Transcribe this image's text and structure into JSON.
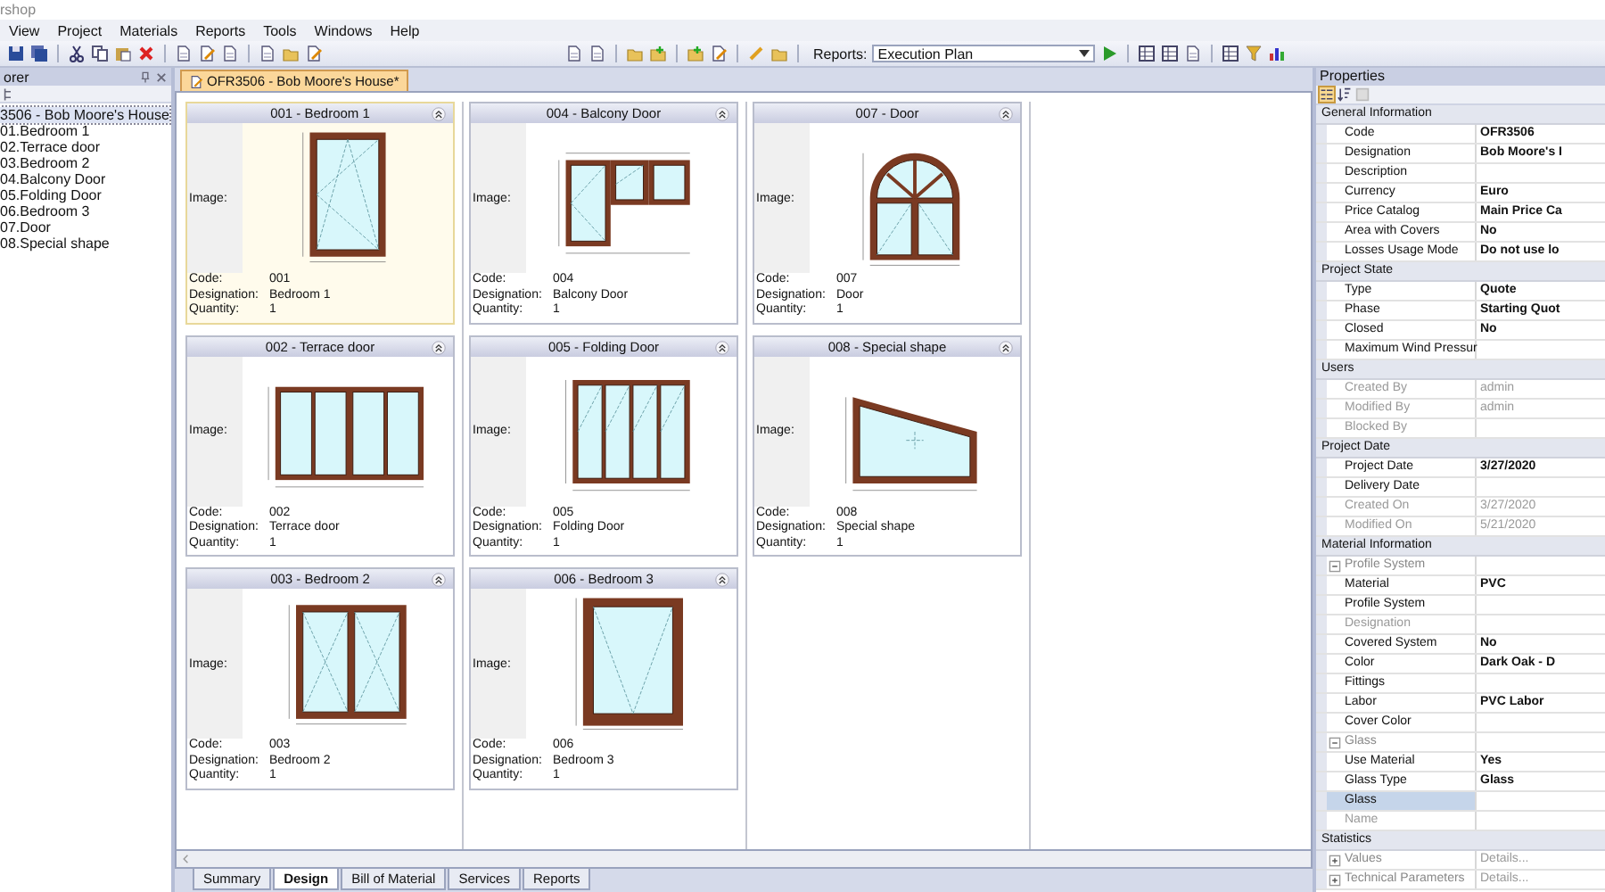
{
  "app": {
    "title": "rshop"
  },
  "menu": [
    "View",
    "Project",
    "Materials",
    "Reports",
    "Tools",
    "Windows",
    "Help"
  ],
  "toolbar": {
    "reports_label": "Reports:",
    "reports_value": "Execution Plan"
  },
  "explorer": {
    "title": "orer",
    "tree": {
      "label": "3506 - Bob Moore's House",
      "selected": true,
      "children": [
        {
          "label": "01.Bedroom 1",
          "selected": false
        },
        {
          "label": "02.Terrace door",
          "selected": false
        },
        {
          "label": "03.Bedroom 2",
          "selected": false
        },
        {
          "label": "04.Balcony Door",
          "selected": false
        },
        {
          "label": "05.Folding Door",
          "selected": false
        },
        {
          "label": "06.Bedroom 3",
          "selected": false
        },
        {
          "label": "07.Door",
          "selected": false
        },
        {
          "label": "08.Special shape",
          "selected": false
        }
      ]
    }
  },
  "document_tab": {
    "title": "OFR3506 - Bob Moore's House*"
  },
  "columns": [
    [
      {
        "title": "001 - Bedroom 1",
        "kind": "casement",
        "selected": true,
        "image_label": "Image:",
        "code_label": "Code:",
        "code": "001",
        "designation_label": "Designation:",
        "designation": "Bedroom 1",
        "quantity_label": "Quantity:",
        "quantity": "1"
      },
      {
        "title": "002 - Terrace door",
        "kind": "sliding",
        "selected": false,
        "image_label": "Image:",
        "code_label": "Code:",
        "code": "002",
        "designation_label": "Designation:",
        "designation": "Terrace door",
        "quantity_label": "Quantity:",
        "quantity": "1"
      },
      {
        "title": "003 - Bedroom 2",
        "kind": "double",
        "selected": false,
        "image_label": "Image:",
        "code_label": "Code:",
        "code": "003",
        "designation_label": "Designation:",
        "designation": "Bedroom 2",
        "quantity_label": "Quantity:",
        "quantity": "1"
      }
    ],
    [
      {
        "title": "004 - Balcony Door",
        "kind": "balcony",
        "selected": false,
        "image_label": "Image:",
        "code_label": "Code:",
        "code": "004",
        "designation_label": "Designation:",
        "designation": "Balcony Door",
        "quantity_label": "Quantity:",
        "quantity": "1"
      },
      {
        "title": "005 - Folding Door",
        "kind": "folding",
        "selected": false,
        "image_label": "Image:",
        "code_label": "Code:",
        "code": "005",
        "designation_label": "Designation:",
        "designation": "Folding Door",
        "quantity_label": "Quantity:",
        "quantity": "1"
      },
      {
        "title": "006 - Bedroom 3",
        "kind": "fixed",
        "selected": false,
        "image_label": "Image:",
        "code_label": "Code:",
        "code": "006",
        "designation_label": "Designation:",
        "designation": "Bedroom 3",
        "quantity_label": "Quantity:",
        "quantity": "1"
      }
    ],
    [
      {
        "title": "007 - Door",
        "kind": "arched",
        "selected": false,
        "image_label": "Image:",
        "code_label": "Code:",
        "code": "007",
        "designation_label": "Designation:",
        "designation": "Door",
        "quantity_label": "Quantity:",
        "quantity": "1"
      },
      {
        "title": "008 - Special shape",
        "kind": "special",
        "selected": false,
        "image_label": "Image:",
        "code_label": "Code:",
        "code": "008",
        "designation_label": "Designation:",
        "designation": "Special shape",
        "quantity_label": "Quantity:",
        "quantity": "1"
      }
    ]
  ],
  "bottom_tabs": [
    {
      "label": "Summary",
      "selected": false
    },
    {
      "label": "Design",
      "selected": true
    },
    {
      "label": "Bill of Material",
      "selected": false
    },
    {
      "label": "Services",
      "selected": false
    },
    {
      "label": "Reports",
      "selected": false
    }
  ],
  "properties": {
    "title": "Properties",
    "categories": [
      {
        "title": "General Information",
        "items": [
          {
            "kind": "property",
            "label": "Code",
            "value": "OFR3506",
            "disabled": false,
            "selected": false
          },
          {
            "kind": "property",
            "label": "Designation",
            "value": "Bob Moore's I",
            "disabled": false,
            "selected": false
          },
          {
            "kind": "property",
            "label": "Description",
            "disabled": false,
            "selected": false
          },
          {
            "kind": "property",
            "label": "Currency",
            "value": "Euro",
            "disabled": false,
            "selected": false
          },
          {
            "kind": "property",
            "label": "Price Catalog",
            "value": "Main Price Ca",
            "disabled": false,
            "selected": false
          },
          {
            "kind": "property",
            "label": "Area with Covers",
            "value": "No",
            "disabled": false,
            "selected": false
          },
          {
            "kind": "property",
            "label": "Losses Usage Mode",
            "value": "Do not use lo",
            "disabled": false,
            "selected": false
          }
        ]
      },
      {
        "title": "Project State",
        "items": [
          {
            "kind": "property",
            "label": "Type",
            "value": "Quote",
            "disabled": false,
            "selected": false
          },
          {
            "kind": "property",
            "label": "Phase",
            "value": "Starting Quot",
            "disabled": false,
            "selected": false
          },
          {
            "kind": "property",
            "label": "Closed",
            "value": "No",
            "disabled": false,
            "selected": false
          },
          {
            "kind": "property",
            "label": "Maximum Wind Pressur",
            "disabled": false,
            "selected": false
          }
        ]
      },
      {
        "title": "Users",
        "items": [
          {
            "kind": "property",
            "label": "Created By",
            "value": "admin",
            "disabled": true,
            "selected": false
          },
          {
            "kind": "property",
            "label": "Modified By",
            "value": "admin",
            "disabled": true,
            "selected": false
          },
          {
            "kind": "property",
            "label": "Blocked By",
            "disabled": true,
            "selected": false
          }
        ]
      },
      {
        "title": "Project Date",
        "items": [
          {
            "kind": "property",
            "label": "Project Date",
            "value": "3/27/2020",
            "disabled": false,
            "selected": false
          },
          {
            "kind": "property",
            "label": "Delivery Date",
            "disabled": false,
            "selected": false
          },
          {
            "kind": "property",
            "label": "Created On",
            "value": "3/27/2020",
            "disabled": true,
            "selected": false
          },
          {
            "kind": "property",
            "label": "Modified On",
            "value": "5/21/2020",
            "disabled": true,
            "selected": false
          }
        ]
      },
      {
        "title": "Material Information",
        "items": [
          {
            "kind": "group",
            "label": "Profile System",
            "expanded": true,
            "children": [
              {
                "kind": "property",
                "label": "Material",
                "value": "PVC",
                "disabled": false,
                "selected": false
              },
              {
                "kind": "property",
                "label": "Profile System",
                "disabled": false,
                "selected": false
              },
              {
                "kind": "property",
                "label": "Designation",
                "disabled": true,
                "selected": false
              },
              {
                "kind": "property",
                "label": "Covered System",
                "value": "No",
                "disabled": false,
                "selected": false
              },
              {
                "kind": "property",
                "label": "Color",
                "value": "Dark Oak - D",
                "disabled": false,
                "selected": false
              },
              {
                "kind": "property",
                "label": "Fittings",
                "disabled": false,
                "selected": false
              },
              {
                "kind": "property",
                "label": "Labor",
                "value": "PVC Labor",
                "disabled": false,
                "selected": false
              },
              {
                "kind": "property",
                "label": "Cover Color",
                "disabled": false,
                "selected": false
              }
            ]
          },
          {
            "kind": "group",
            "label": "Glass",
            "expanded": true,
            "children": [
              {
                "kind": "property",
                "label": "Use Material",
                "value": "Yes",
                "disabled": false,
                "selected": false
              },
              {
                "kind": "property",
                "label": "Glass Type",
                "value": "Glass",
                "disabled": false,
                "selected": false
              },
              {
                "kind": "property",
                "label": "Glass",
                "disabled": false,
                "selected": true
              },
              {
                "kind": "property",
                "label": "Name",
                "disabled": true,
                "selected": false
              }
            ]
          }
        ]
      },
      {
        "title": "Statistics",
        "items": [
          {
            "kind": "group",
            "label": "Values",
            "value": "Details...",
            "expanded": false
          },
          {
            "kind": "group",
            "label": "Technical Parameters",
            "value": "Details...",
            "expanded": false
          }
        ]
      }
    ]
  }
}
